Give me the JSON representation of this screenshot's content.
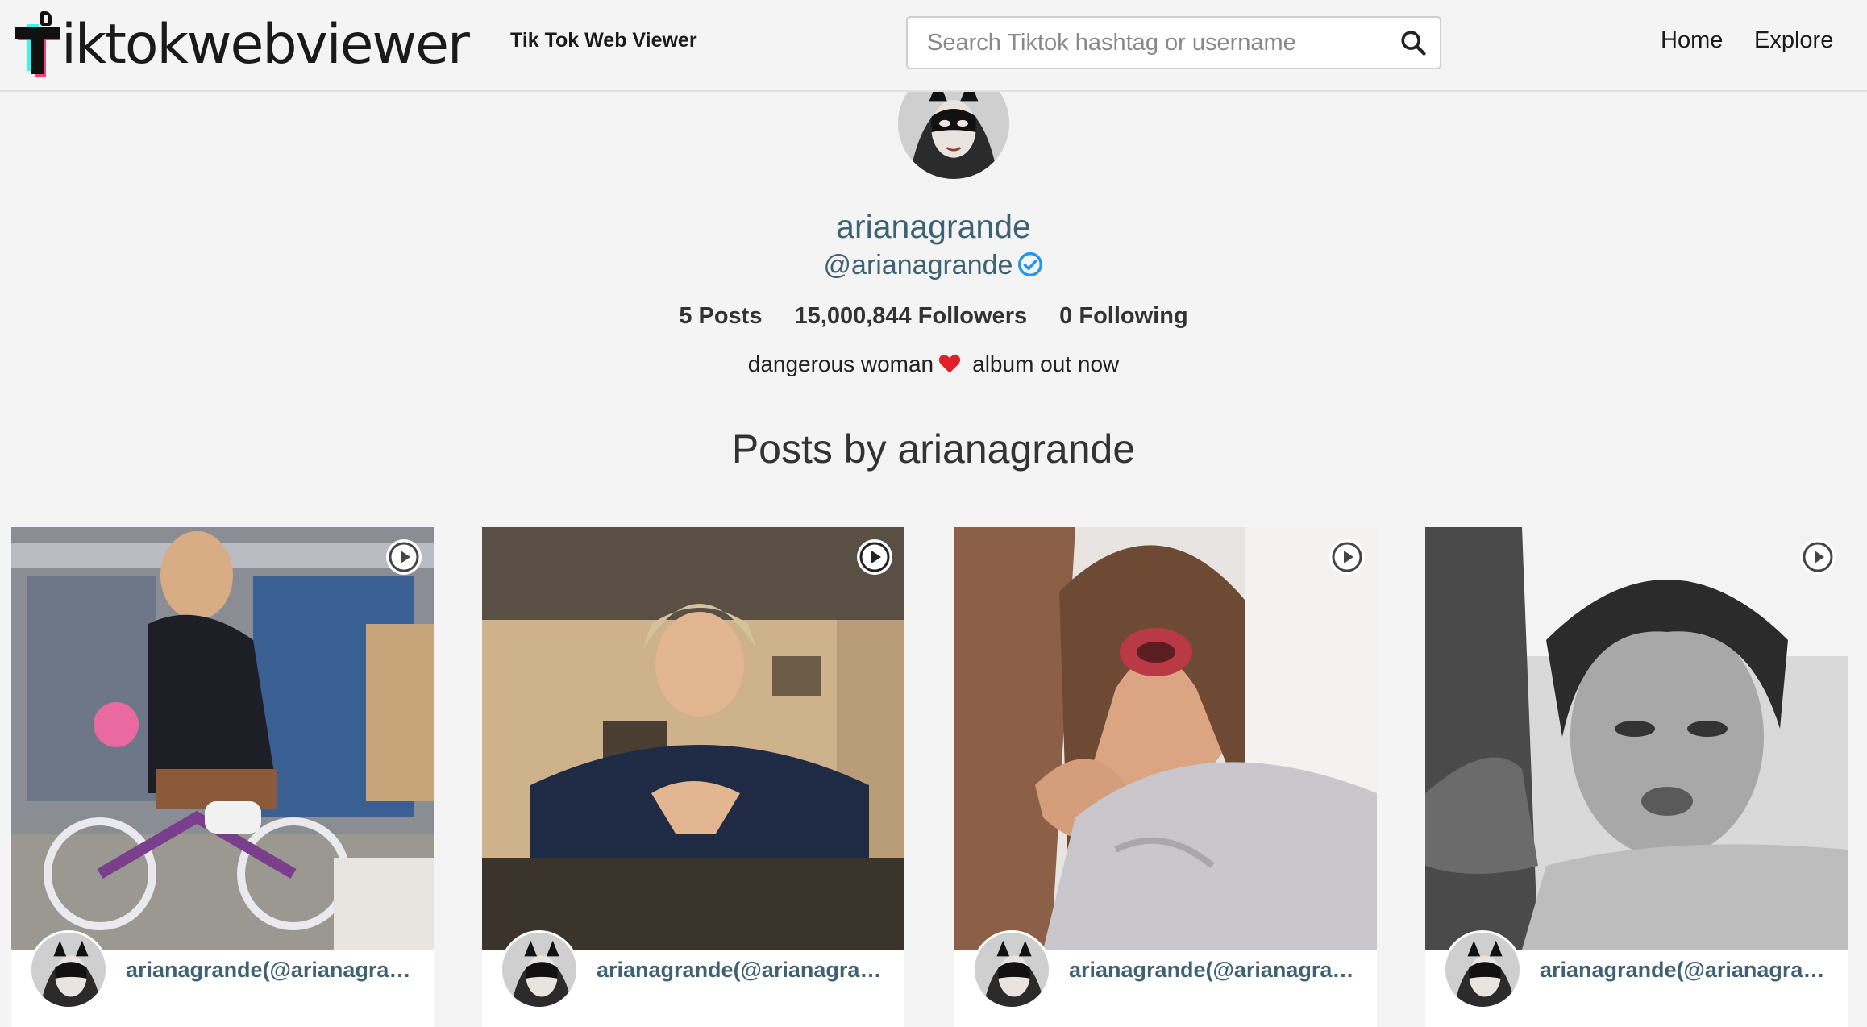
{
  "header": {
    "logo_text": "iktokwebviewer",
    "tagline": "Tik Tok Web Viewer",
    "search_placeholder": "Search Tiktok hashtag or username",
    "nav": {
      "home": "Home",
      "explore": "Explore"
    }
  },
  "profile": {
    "name": "arianagrande",
    "handle": "@arianagrande",
    "verified": true,
    "stats": {
      "posts": "5 Posts",
      "followers": "15,000,844 Followers",
      "following": "0 Following"
    },
    "bio_before": "dangerous woman",
    "bio_after": "album out now"
  },
  "posts_section": {
    "title": "Posts by arianagrande",
    "cards": [
      {
        "label": "arianagrande(@arianagrande)"
      },
      {
        "label": "arianagrande(@arianagrande)"
      },
      {
        "label": "arianagrande(@arianagrande)"
      },
      {
        "label": "arianagrande(@arianagrande)"
      }
    ]
  },
  "colors": {
    "accent_text": "#3f6272",
    "verified_blue": "#2196f3",
    "heart_red": "#e0202b",
    "logo_pink": "#ff2e63",
    "logo_cyan": "#25f4ee"
  },
  "icons": [
    "search-icon",
    "verified-badge-icon",
    "heart-icon",
    "play-icon"
  ]
}
